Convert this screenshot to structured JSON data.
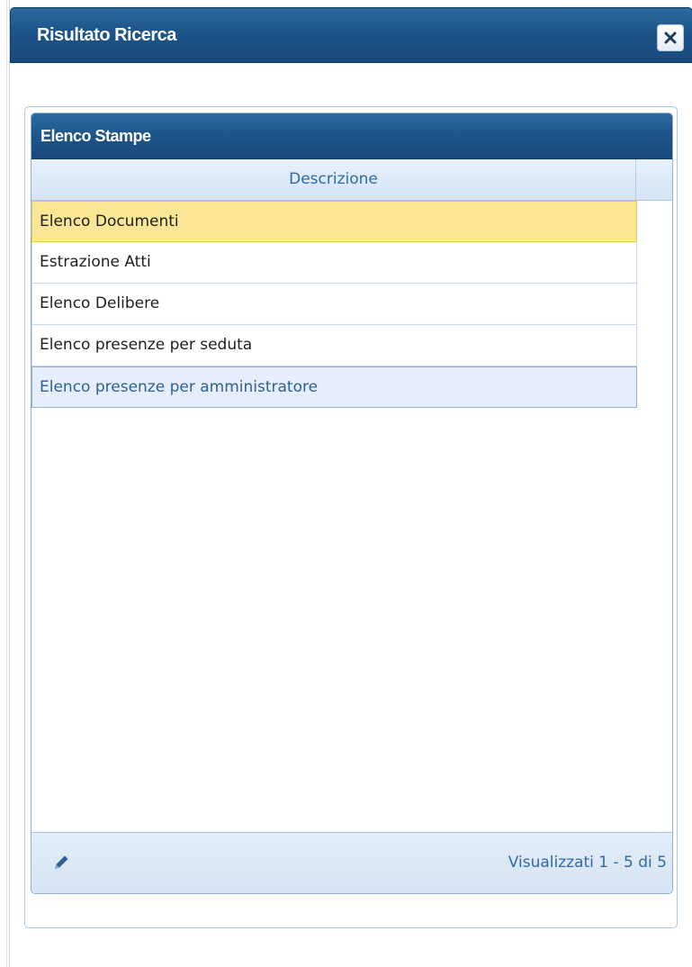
{
  "dialog": {
    "title": "Risultato Ricerca",
    "close_icon": "close-icon"
  },
  "grid": {
    "caption": "Elenco Stampe",
    "columns": [
      "Descrizione"
    ],
    "rows": [
      {
        "descrizione": "Elenco Documenti",
        "state": "selected"
      },
      {
        "descrizione": "Estrazione Atti",
        "state": "normal"
      },
      {
        "descrizione": "Elenco Delibere",
        "state": "normal"
      },
      {
        "descrizione": "Elenco presenze per seduta",
        "state": "normal"
      },
      {
        "descrizione": "Elenco presenze per amministratore",
        "state": "hover"
      }
    ],
    "footer": {
      "edit_icon": "pencil-icon",
      "pager": "Visualizzati 1 - 5 di 5"
    }
  },
  "colors": {
    "header_blue": "#1d5489",
    "selected_row": "#fbe695",
    "hover_row": "#e6eefb",
    "link_blue": "#2e6aa6"
  }
}
